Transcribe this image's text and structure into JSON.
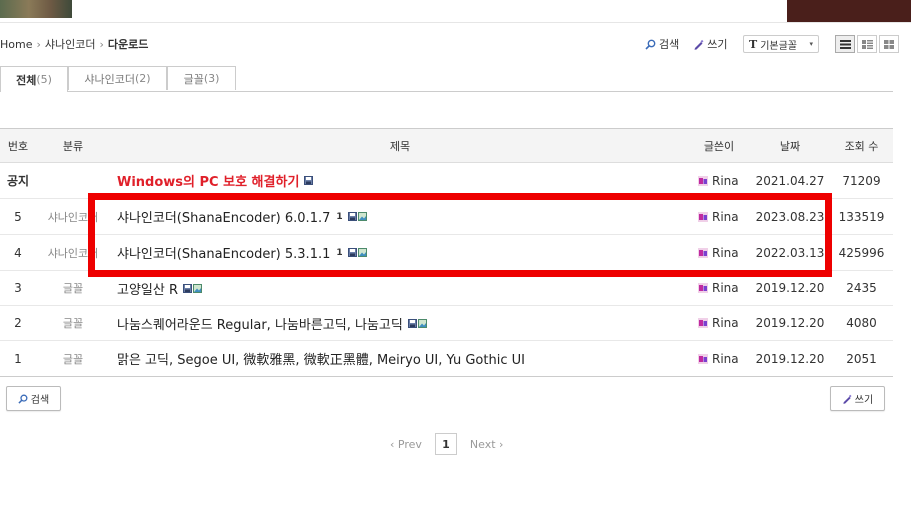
{
  "breadcrumb": {
    "home": "Home",
    "category": "샤나인코더",
    "current": "다운로드"
  },
  "tools": {
    "search_label": "검색",
    "write_label": "쓰기",
    "font_value": "기본글꼴",
    "font_glyph": "T"
  },
  "tabs": [
    {
      "label": "전체",
      "count": "(5)"
    },
    {
      "label": "샤나인코더",
      "count": "(2)"
    },
    {
      "label": "글꼴",
      "count": "(3)"
    }
  ],
  "table": {
    "headers": {
      "num": "번호",
      "category": "분류",
      "title": "제목",
      "author": "글쓴이",
      "date": "날짜",
      "views": "조회 수"
    },
    "notice": {
      "num": "공지",
      "category": "",
      "title": "Windows의 PC 보호 해결하기",
      "author": "Rina",
      "date": "2021.04.27",
      "views": "71209"
    },
    "rows": [
      {
        "num": "5",
        "category": "샤나인코더",
        "title": "샤나인코더(ShanaEncoder) 6.0.1.7",
        "comments": "1",
        "author": "Rina",
        "date": "2023.08.23",
        "views": "133519"
      },
      {
        "num": "4",
        "category": "샤나인코더",
        "title": "샤나인코더(ShanaEncoder) 5.3.1.1",
        "comments": "1",
        "author": "Rina",
        "date": "2022.03.13",
        "views": "425996"
      },
      {
        "num": "3",
        "category": "글꼴",
        "title": "고양일산 R",
        "comments": "",
        "author": "Rina",
        "date": "2019.12.20",
        "views": "2435"
      },
      {
        "num": "2",
        "category": "글꼴",
        "title": "나눔스퀘어라운드 Regular, 나눔바른고딕, 나눔고딕",
        "comments": "",
        "author": "Rina",
        "date": "2019.12.20",
        "views": "4080"
      },
      {
        "num": "1",
        "category": "글꼴",
        "title": "맑은 고딕, Segoe UI, 微軟雅黑, 微軟正黑體, Meiryo UI, Yu Gothic UI",
        "comments": "",
        "author": "Rina",
        "date": "2019.12.20",
        "views": "2051"
      }
    ]
  },
  "bottom": {
    "search_label": "검색",
    "write_label": "쓰기"
  },
  "pager": {
    "prev": "‹ Prev",
    "current": "1",
    "next": "Next ›"
  },
  "colors": {
    "notice_red": "#e0202a",
    "highlight_box": "#ee0000"
  }
}
